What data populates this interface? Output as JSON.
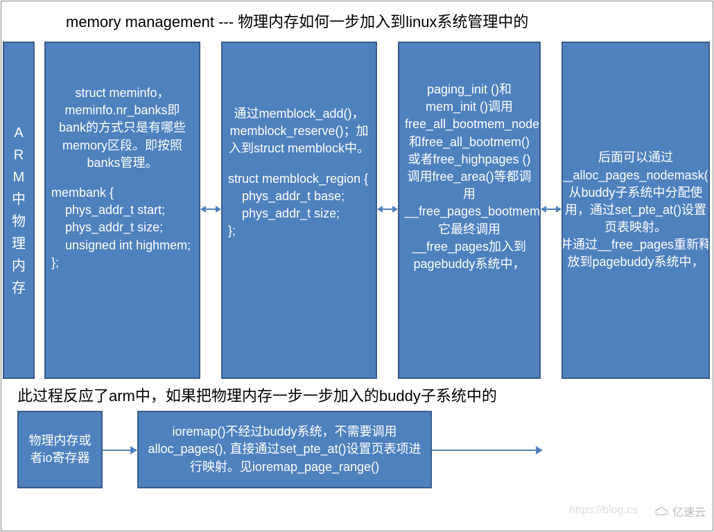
{
  "title": "memory management --- 物理内存如何一步加入到linux系统管理中的",
  "subtitle": "此过程反应了arm中，如果把物理内存一步一步加入的buddy子系统中的",
  "row1": {
    "sidebar": "ARM中物理内存",
    "box1_top": "struct meminfo，meminfo.nr_banks即bank的方式只是有哪些memory区段。即按照banks管理。",
    "box1_code": "membank {\n    phys_addr_t start;\n    phys_addr_t size;\n    unsigned int highmem;\n};",
    "box2_top": "通过memblock_add()，memblock_reserve()；加入到struct memblock中。",
    "box2_code": "struct memblock_region {\n    phys_addr_t base;\n    phys_addr_t size;\n};",
    "box3": "paging_init ()和mem_init ()调用free_all_bootmem_node()和free_all_bootmem()或者free_highpages ()调用free_area()等都调用__free_pages_bootmem(),它最终调用__free_pages加入到pagebuddy系统中，",
    "box4": "后面可以通过__alloc_pages_nodemask()从buddy子系统中分配使用，通过set_pte_at()设置页表映射。\n并通过__free_pages重新释放到pagebuddy系统中，"
  },
  "row2": {
    "box1": "物理内存或者io寄存器",
    "box2": "ioremap()不经过buddy系统，不需要调用alloc_pages(), 直接通过set_pte_at()设置页表项进行映射。见ioremap_page_range()"
  },
  "watermark1": "https://blog.cs",
  "watermark2": "亿速云"
}
